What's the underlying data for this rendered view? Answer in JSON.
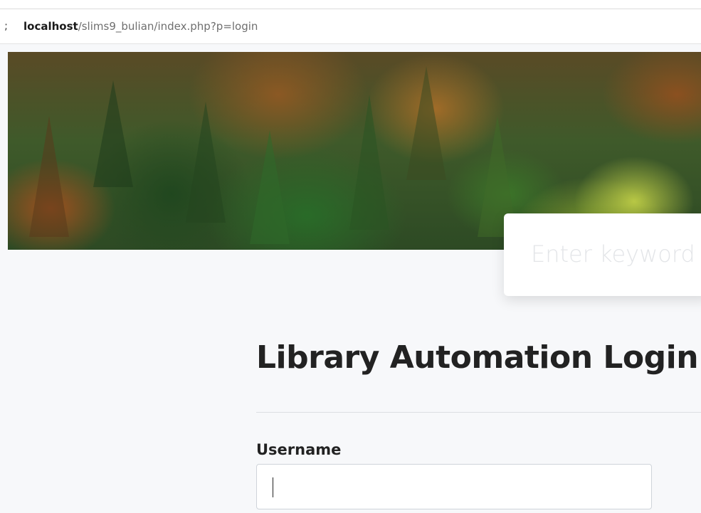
{
  "browser": {
    "address_host": "localhost",
    "address_path": "/slims9_bulian/index.php?p=login",
    "address_edge_glyph": ";"
  },
  "search": {
    "placeholder": "Enter keyword to search collection..."
  },
  "login": {
    "title": "Library Automation Login",
    "username_label": "Username",
    "username_value": ""
  }
}
